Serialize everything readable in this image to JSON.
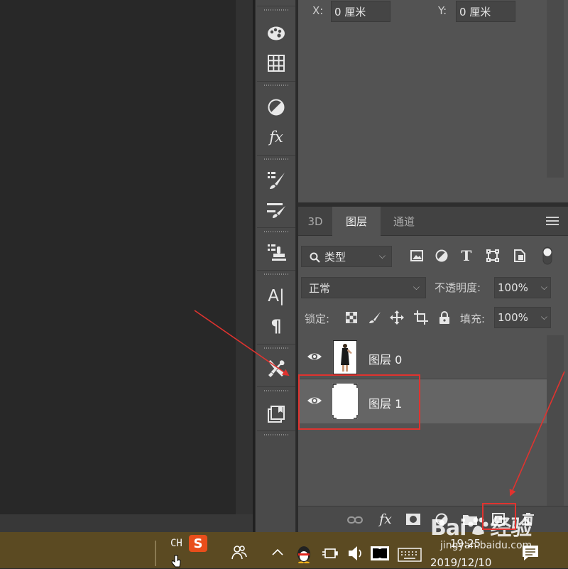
{
  "properties": {
    "x_label": "X:",
    "x_value": "0 厘米",
    "y_label": "Y:",
    "y_value": "0 厘米"
  },
  "layers_panel": {
    "tabs": [
      "3D",
      "图层",
      "通道"
    ],
    "active_tab": "图层",
    "filter": {
      "label": "类型"
    },
    "blend_mode": "正常",
    "opacity_label": "不透明度:",
    "opacity_value": "100%",
    "lock_label": "锁定:",
    "fill_label": "填充:",
    "fill_value": "100%",
    "layers": [
      {
        "name": "图层 0",
        "selected": false
      },
      {
        "name": "图层 1",
        "selected": true
      }
    ],
    "bottom_fx_label": "fx"
  },
  "toolstrip": {
    "type_tool_label": "A|",
    "paragraph_label": "¶"
  },
  "taskbar": {
    "lang": "CH",
    "ime_label": "S",
    "time": "19:25",
    "date": "2019/12/10"
  },
  "watermark": {
    "brand": "Bai",
    "brand_suffix": "经验",
    "url": "jingyan.baidu.com"
  },
  "colors": {
    "accent_red": "#e0332f",
    "panel_bg": "#535353",
    "selected_row": "#656565",
    "taskbar": "#5b4a22"
  }
}
